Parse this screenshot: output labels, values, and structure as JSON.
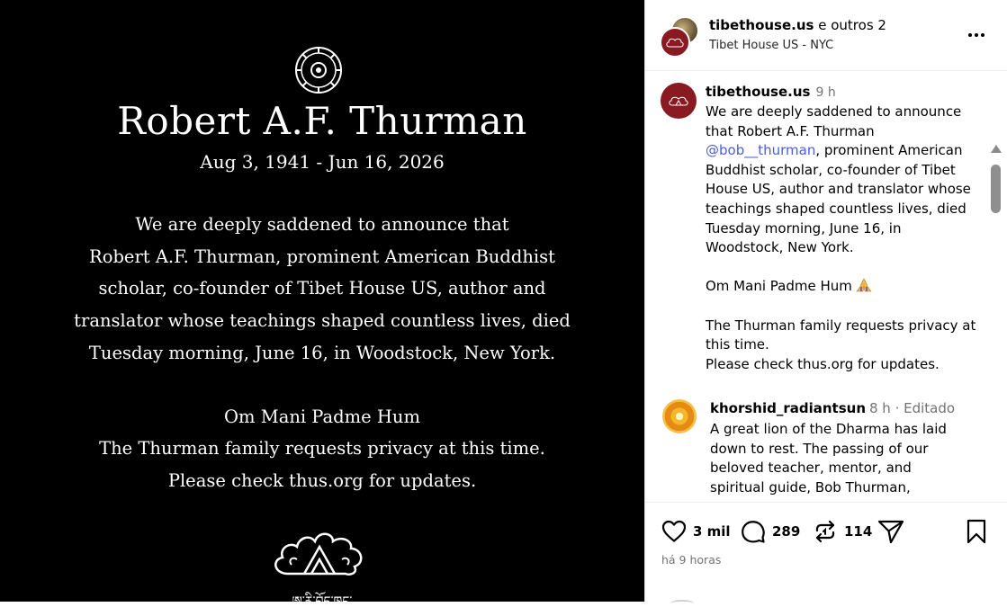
{
  "image": {
    "name": "Robert A.F. Thurman",
    "dates": "Aug 3, 1941 - Jun 16, 2026",
    "announcement_lines": [
      "We are deeply saddened to announce that",
      "Robert A.F. Thurman, prominent American Buddhist",
      "scholar,  co-founder of Tibet House US, author and",
      "translator whose teachings shaped countless lives, died",
      "Tuesday morning, June 16, in Woodstock, New York."
    ],
    "closing_lines": [
      "Om Mani Padme Hum",
      "The Thurman family requests privacy at this time.",
      "Please check thus.org for updates."
    ],
    "tibetan_text": "ཨ་རི་བོད་ཁང་"
  },
  "header": {
    "username": "tibethouse.us",
    "collab_suffix": " e outros 2",
    "location": "Tibet House US - NYC"
  },
  "caption": {
    "username": "tibethouse.us",
    "time": "9 h",
    "line1": "We are deeply saddened to announce",
    "line2": "that Robert A.F. Thurman",
    "mention": "@bob__thurman",
    "line3_rest": ", prominent American",
    "line4": "Buddhist scholar, co-founder of Tibet",
    "line5": "House US, author and translator whose",
    "line6": "teachings shaped countless lives, died",
    "line7": "Tuesday morning, June 16, in",
    "line8": "Woodstock, New York.",
    "line9": "Om Mani Padme Hum",
    "line10": "The Thurman family requests privacy at",
    "line11": "this time.",
    "line12": "Please check thus.org for updates."
  },
  "comment": {
    "username": "khorshid_radiantsun",
    "time": "8 h · Editado",
    "line1": "A great lion of the Dharma has laid",
    "line2": "down to rest. The passing of our",
    "line3": "beloved teacher, mentor, and",
    "line4": "spiritual guide, Bob Thurman,"
  },
  "actions": {
    "likes": "3 mil",
    "comments": "289",
    "reposts": "114",
    "timestamp": "há 9 horas"
  },
  "icons": {
    "like": "heart-icon",
    "comment": "comment-bubble-icon",
    "repost": "repost-icon",
    "share": "send-icon",
    "save": "bookmark-icon",
    "more": "more-options-icon",
    "pray": "folded-hands-icon"
  },
  "colors": {
    "mention": "#4a5de0",
    "avatar_brand": "#8a1a22",
    "muted": "#737373"
  }
}
